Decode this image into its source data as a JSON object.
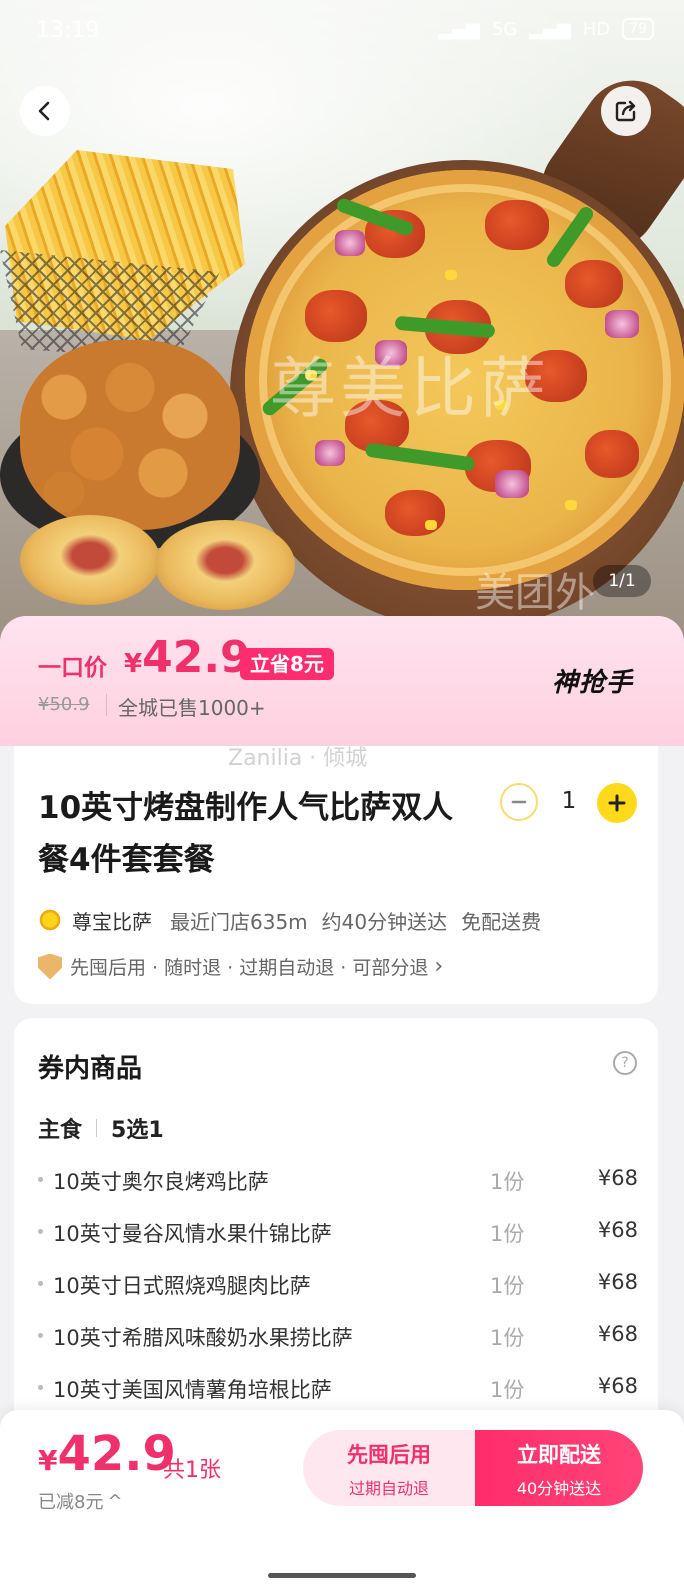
{
  "status_bar": {
    "time": "13:19",
    "network": "5G",
    "hd": "HD",
    "battery": "79"
  },
  "image_counter": "1/1",
  "watermarks": {
    "hero_main": "尊美比萨",
    "hero_corner": "美团外",
    "banner": "Zanilia · 倾城"
  },
  "price_banner": {
    "label": "一口价",
    "currency": "¥",
    "price": "42.9",
    "save_badge": "立省8元",
    "original_price": "¥50.9",
    "sold_text": "全城已售1000+",
    "logo_text": "神抢手"
  },
  "product": {
    "title": "10英寸烤盘制作人气比萨双人餐4件套套餐",
    "quantity": "1",
    "shop_name": "尊宝比萨",
    "distance": "最近门店635m",
    "delivery_time": "约40分钟送达",
    "delivery_fee": "免配送费",
    "guarantee": "先囤后用 · 随时退 · 过期自动退 · 可部分退",
    "guarantee_arrow": "›"
  },
  "items_section": {
    "title": "券内商品",
    "help": "?",
    "group_name": "主食",
    "group_rule": "5选1",
    "items": [
      {
        "name": "10英寸奥尔良烤鸡比萨",
        "count": "1份",
        "price": "¥68"
      },
      {
        "name": "10英寸曼谷风情水果什锦比萨",
        "count": "1份",
        "price": "¥68"
      },
      {
        "name": "10英寸日式照烧鸡腿肉比萨",
        "count": "1份",
        "price": "¥68"
      },
      {
        "name": "10英寸希腊风味酸奶水果捞比萨",
        "count": "1份",
        "price": "¥68"
      },
      {
        "name": "10英寸美国风情薯角培根比萨",
        "count": "1份",
        "price": "¥68"
      }
    ]
  },
  "bottom_bar": {
    "currency": "¥",
    "price": "42.9",
    "count": "共1张",
    "saved": "已减8元",
    "saved_arrow": "^",
    "btn_later_main": "先囤后用",
    "btn_later_sub": "过期自动退",
    "btn_now_main": "立即配送",
    "btn_now_sub": "40分钟送达"
  },
  "colors": {
    "accent": "#f0306a",
    "badge": "#ff2d6f",
    "plus_button": "#ffd91a"
  }
}
